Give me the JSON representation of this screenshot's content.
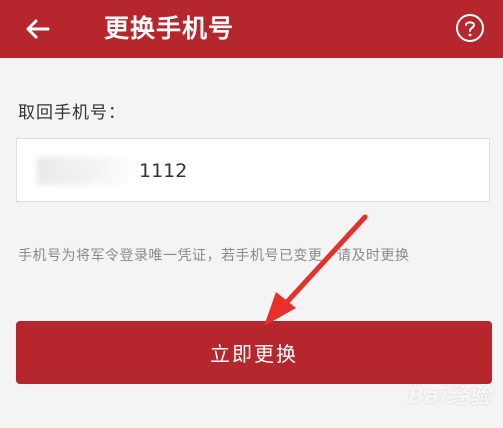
{
  "header": {
    "title": "更换手机号",
    "back_icon": "back-arrow-icon",
    "help_icon": "question-mark-icon"
  },
  "form": {
    "label": "取回手机号：",
    "phone_value": "1112"
  },
  "hint": {
    "text": "手机号为将军令登录唯一凭证，若手机号已变更，请及时更换"
  },
  "action": {
    "change_label": "立即更换"
  },
  "watermark": {
    "text": "Bai经验"
  },
  "colors": {
    "accent": "#b5272d",
    "annotation_arrow": "#e8302b",
    "background": "#f4f4f4"
  }
}
